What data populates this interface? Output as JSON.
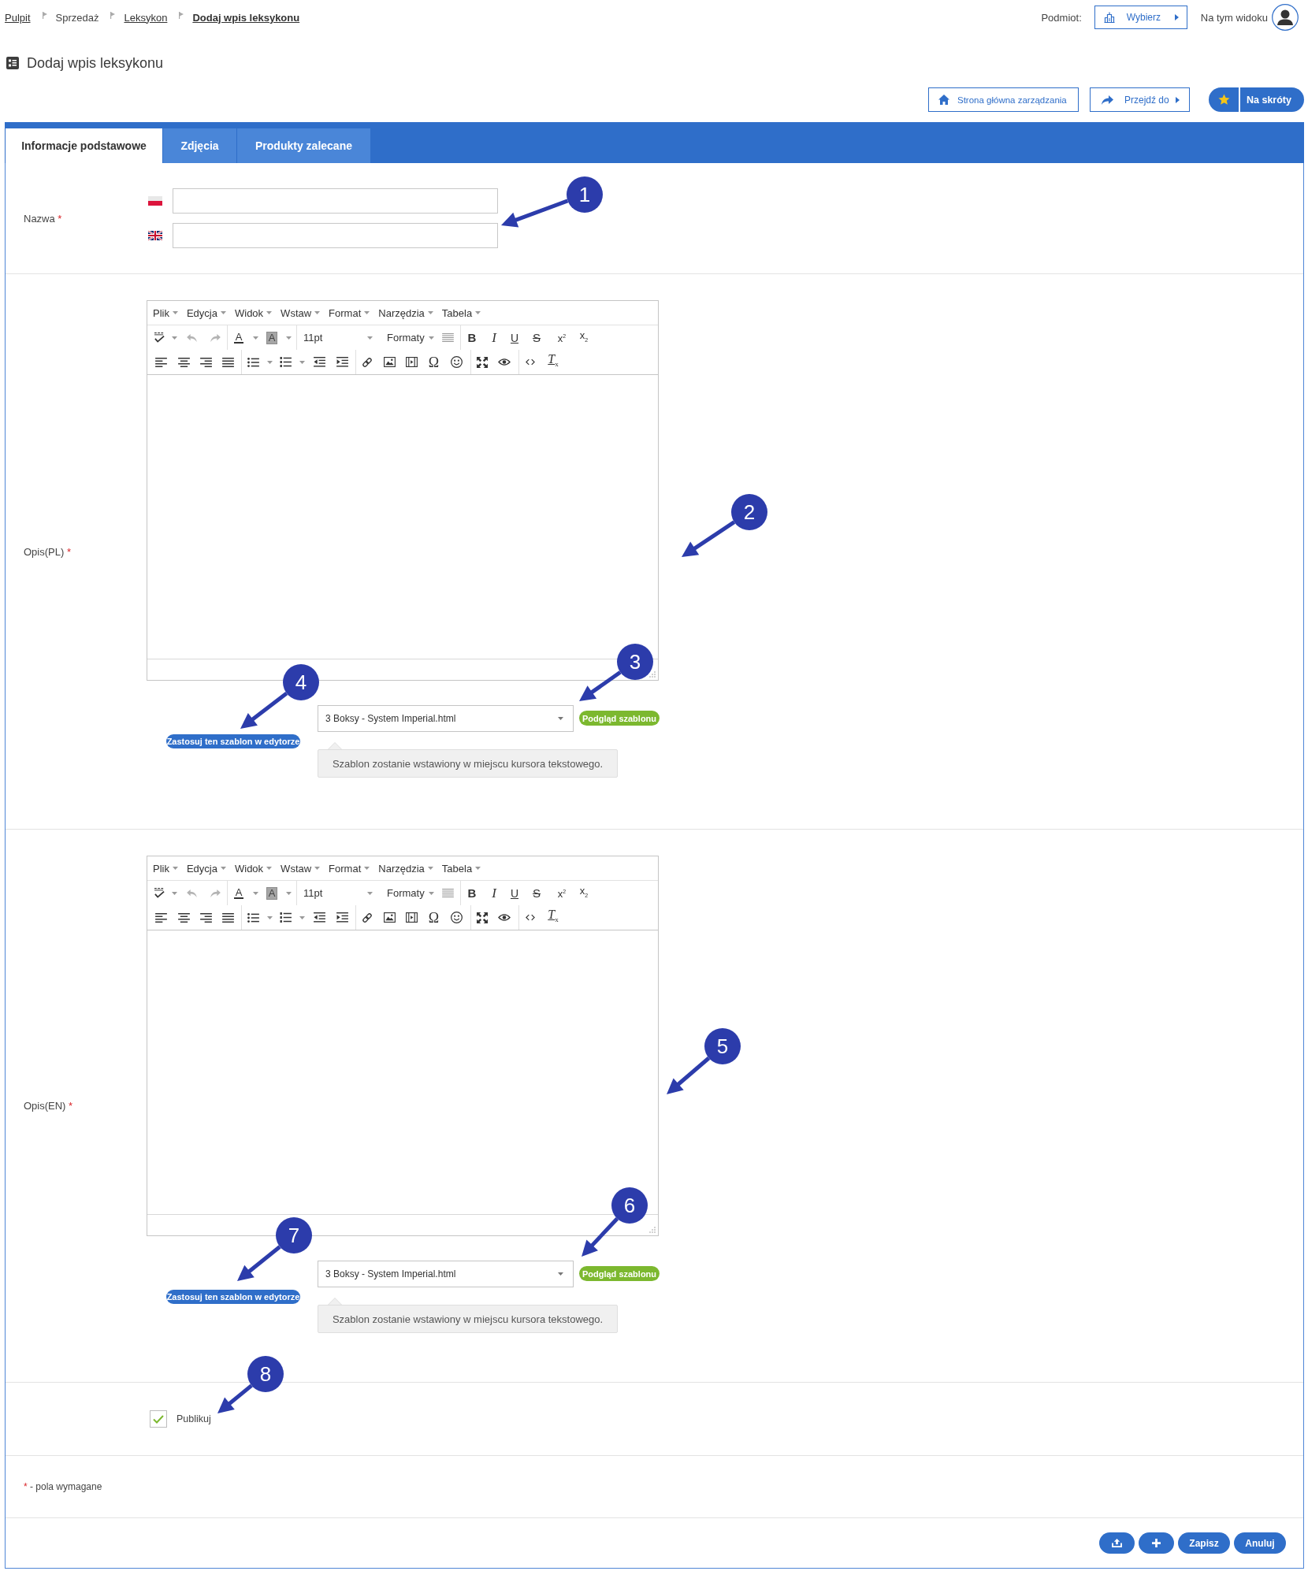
{
  "breadcrumbs": [
    {
      "label": "Pulpit",
      "kind": "link"
    },
    {
      "label": "Sprzedaż",
      "kind": "text"
    },
    {
      "label": "Leksykon",
      "kind": "link"
    },
    {
      "label": "Dodaj wpis leksykonu",
      "kind": "current"
    }
  ],
  "header": {
    "subject_label": "Podmiot:",
    "subject_button": "Wybierz",
    "view_label": "Na tym widoku"
  },
  "page_title": "Dodaj wpis leksykonu",
  "actions": [
    {
      "label": "Strona główna zarządzania",
      "kind": "home"
    },
    {
      "label": "Przejdź do",
      "kind": "goto"
    },
    {
      "label": "Na skróty",
      "kind": "shortcuts"
    }
  ],
  "tabs": [
    {
      "label": "Informacje podstawowe",
      "selected": true
    },
    {
      "label": "Zdjęcia",
      "selected": false
    },
    {
      "label": "Produkty zalecane",
      "selected": false
    }
  ],
  "name_field": {
    "label": "Nazwa",
    "required_mark": "*",
    "inputs": [
      {
        "kind": "polish"
      },
      {
        "kind": "british"
      }
    ]
  },
  "editors": [
    {
      "label": "Opis(PL)",
      "required_mark": "*",
      "menu": [
        "Plik",
        "Edycja",
        "Widok",
        "Wstaw",
        "Format",
        "Narzędzia",
        "Tabela"
      ],
      "toolbar": {
        "undo_disabled": true,
        "redo_disabled": true,
        "text_color": "A",
        "background_color": "A",
        "font_size": "11pt",
        "formats": "Formaty",
        "bold": "B",
        "italic": "I",
        "underline": "U",
        "strikethrough": "S",
        "superscript": "x$^{2}$",
        "subscript": "x$_{2}$",
        "special_character": "Ω",
        "clear_formatting": "T$_{x}$"
      },
      "template": {
        "value": "3 Boksy - System Imperial.html",
        "apply_button": "Zastosuj ten szablon w edytorze",
        "preview_button": "Podgląd szablonu",
        "hint": "Szablon zostanie wstawiony w miejscu kursora tekstowego."
      }
    },
    {
      "label": "Opis(EN)",
      "required_mark": "*",
      "menu": [
        "Plik",
        "Edycja",
        "Widok",
        "Wstaw",
        "Format",
        "Narzędzia",
        "Tabela"
      ],
      "toolbar": {
        "undo_disabled": true,
        "redo_disabled": true,
        "text_color": "A",
        "background_color": "A",
        "font_size": "11pt",
        "formats": "Formaty",
        "bold": "B",
        "italic": "I",
        "underline": "U",
        "strikethrough": "S",
        "superscript": "x$^{2}$",
        "subscript": "x$_{2}$",
        "special_character": "Ω",
        "clear_formatting": "T$_{x}$"
      },
      "template": {
        "value": "3 Boksy - System Imperial.html",
        "apply_button": "Zastosuj ten szablon w edytorze",
        "preview_button": "Podgląd szablonu",
        "hint": "Szablon zostanie wstawiony w miejscu kursora tekstowego."
      }
    }
  ],
  "publish": {
    "label": "Publikuj",
    "checked": true
  },
  "required_note": {
    "mark": "*",
    "text": "- pola wymagane"
  },
  "footer_buttons": [
    {
      "kind": "return"
    },
    {
      "kind": "add"
    },
    {
      "kind": "text",
      "label": "Zapisz"
    },
    {
      "kind": "text",
      "label": "Anuluj"
    }
  ],
  "callouts": [
    {
      "number": "1"
    },
    {
      "number": "2"
    },
    {
      "number": "3"
    },
    {
      "number": "4"
    },
    {
      "number": "5"
    },
    {
      "number": "6"
    },
    {
      "number": "7"
    },
    {
      "number": "8"
    }
  ]
}
